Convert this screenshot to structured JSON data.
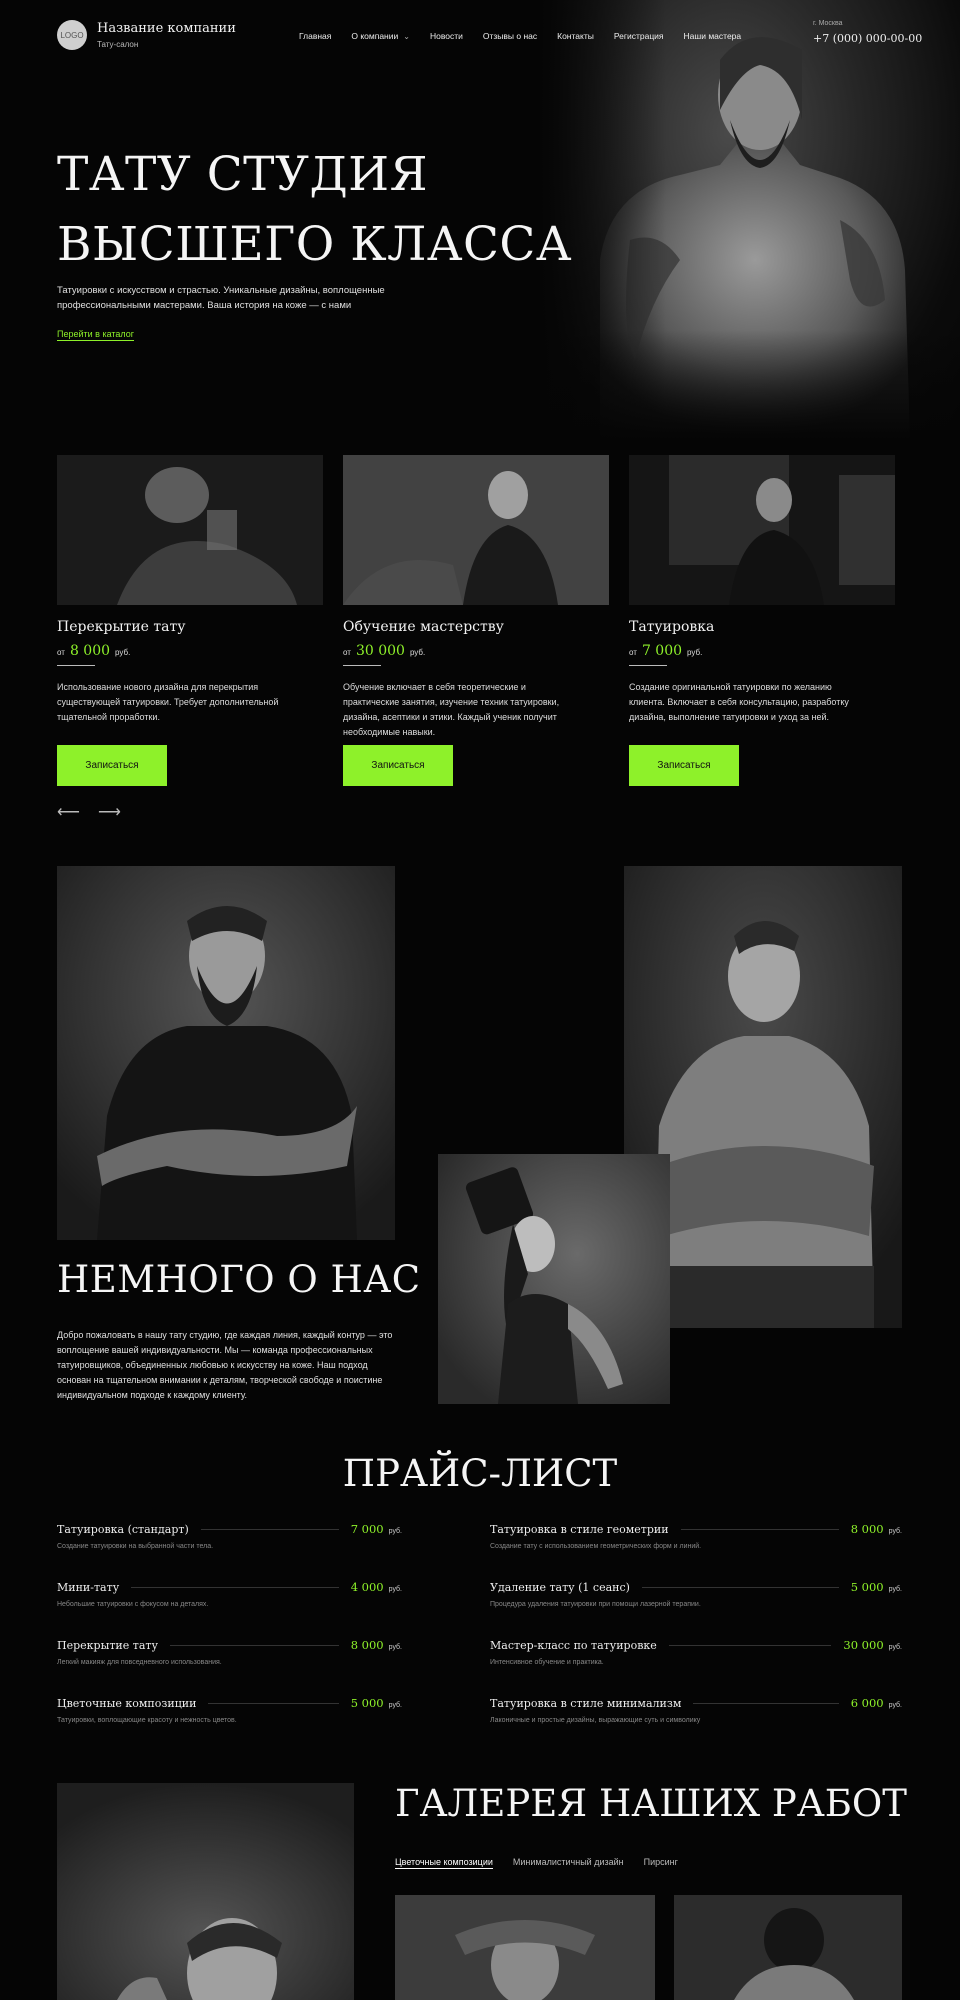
{
  "header": {
    "logo": "LOGO",
    "company_name": "Название компании",
    "company_sub": "Тату-салон",
    "nav": [
      {
        "label": "Главная"
      },
      {
        "label": "О компании"
      },
      {
        "label": "Новости"
      },
      {
        "label": "Отзывы о нас"
      },
      {
        "label": "Контакты"
      },
      {
        "label": "Регистрация"
      },
      {
        "label": "Наши мастера"
      }
    ],
    "city": "г. Москва",
    "phone": "+7 (000) 000-00-00"
  },
  "hero": {
    "title_line1": "ТАТУ СТУДИЯ",
    "title_line2": "ВЫСШЕГО КЛАССА",
    "text": "Татуировки с искусством и страстью. Уникальные дизайны, воплощенные профессиональными мастерами. Ваша история на коже — с нами",
    "link": "Перейти в каталог"
  },
  "services": [
    {
      "title": "Перекрытие тату",
      "from": "от",
      "price": "8 000",
      "currency": "руб.",
      "desc": "Использование нового дизайна для перекрытия существующей татуировки. Требует дополнительной тщательной проработки.",
      "button": "Записаться"
    },
    {
      "title": "Обучение мастерству",
      "from": "от",
      "price": "30 000",
      "currency": "руб.",
      "desc": "Обучение включает в себя теоретические и практические занятия, изучение техник татуировки, дизайна, асептики и этики. Каждый ученик получит необходимые навыки.",
      "button": "Записаться"
    },
    {
      "title": "Татуировка",
      "from": "от",
      "price": "7 000",
      "currency": "руб.",
      "desc": "Создание оригинальной татуировки по желанию клиента. Включает в себя консультацию, разработку дизайна, выполнение татуировки и уход за ней.",
      "button": "Записаться"
    }
  ],
  "arrows": {
    "prev": "⟵",
    "next": "⟶"
  },
  "about": {
    "title": "НЕМНОГО О НАС",
    "text": "Добро пожаловать в нашу тату студию, где каждая линия, каждый контур — это воплощение вашей индивидуальности. Мы — команда профессиональных татуировщиков, объединенных любовью к искусству на коже. Наш подход основан на тщательном внимании к деталям, творческой свободе и поистине индивидуальном подходе к каждому клиенту."
  },
  "price": {
    "title": "ПРАЙС-ЛИСТ",
    "currency": "руб.",
    "left": [
      {
        "name": "Татуировка (стандарт)",
        "price": "7 000",
        "desc": "Создание татуировки на выбранной части тела."
      },
      {
        "name": "Мини-тату",
        "price": "4 000",
        "desc": "Небольшие татуировки с фокусом на деталях."
      },
      {
        "name": "Перекрытие тату",
        "price": "8 000",
        "desc": "Легкий макияж для повседневного использования."
      },
      {
        "name": "Цветочные композиции",
        "price": "5 000",
        "desc": "Татуировки, воплощающие красоту и нежность цветов."
      }
    ],
    "right": [
      {
        "name": "Татуировка в стиле геометрии",
        "price": "8 000",
        "desc": "Создание тату с использованием геометрических форм и линий."
      },
      {
        "name": "Удаление тату (1 сеанс)",
        "price": "5 000",
        "desc": "Процедура удаления татуировки при помощи лазерной терапии."
      },
      {
        "name": "Мастер-класс по татуировке",
        "price": "30 000",
        "desc": "Интенсивное обучение и практика."
      },
      {
        "name": "Татуировка в стиле минимализм",
        "price": "6 000",
        "desc": "Лаконичные и простые дизайны, выражающие суть и символику"
      }
    ]
  },
  "gallery": {
    "title": "ГАЛЕРЕЯ НАШИХ РАБОТ",
    "tabs": [
      "Цветочные композиции",
      "Минималистичный дизайн",
      "Пирсинг"
    ]
  },
  "colors": {
    "accent": "#8ef12a",
    "background": "#050505"
  }
}
